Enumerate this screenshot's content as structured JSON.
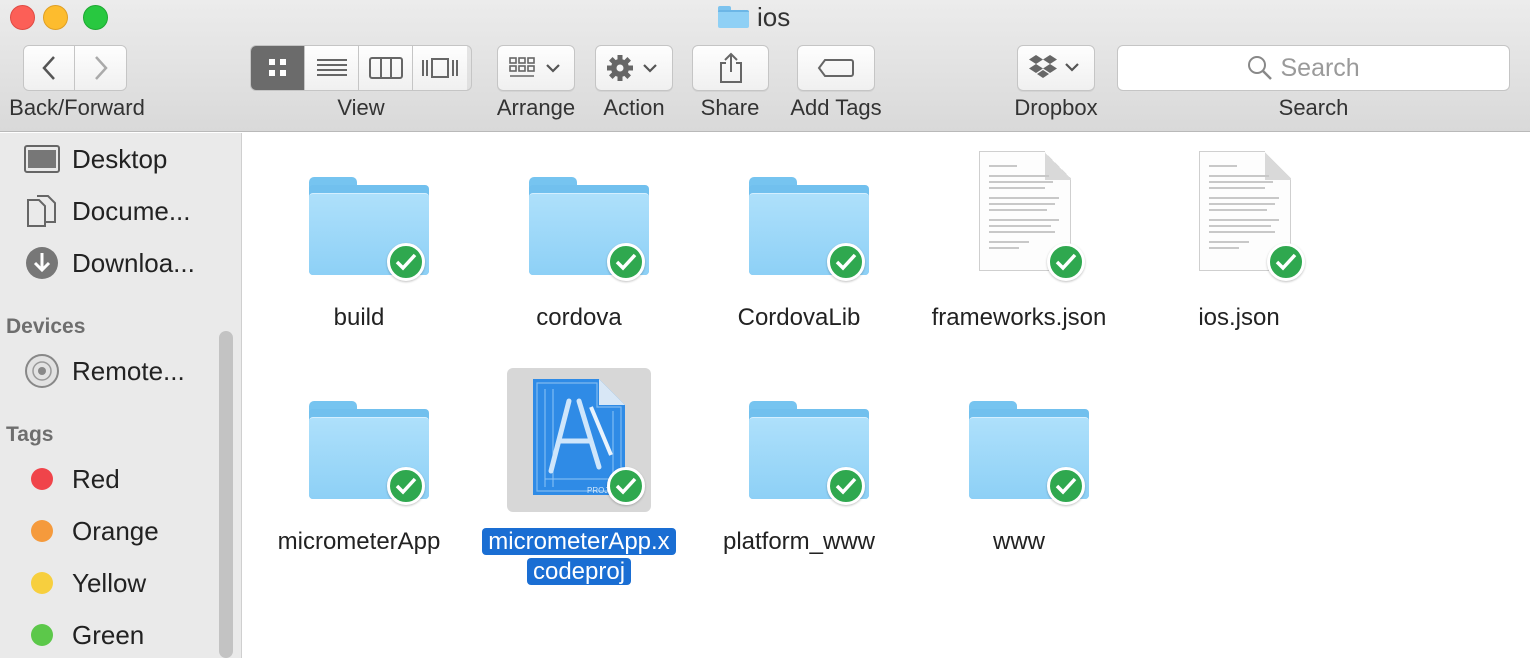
{
  "window": {
    "title": "ios",
    "title_icon": "folder-icon"
  },
  "toolbar": {
    "back_forward_label": "Back/Forward",
    "view_label": "View",
    "arrange_label": "Arrange",
    "action_label": "Action",
    "share_label": "Share",
    "add_tags_label": "Add Tags",
    "dropbox_label": "Dropbox",
    "search_label": "Search",
    "search_placeholder": "Search",
    "active_view": "icon"
  },
  "sidebar": {
    "favorites": [
      {
        "label": "Desktop",
        "icon": "desktop-icon"
      },
      {
        "label": "Docume...",
        "icon": "documents-icon"
      },
      {
        "label": "Downloa...",
        "icon": "downloads-icon"
      }
    ],
    "devices_heading": "Devices",
    "devices": [
      {
        "label": "Remote...",
        "icon": "disc-icon"
      }
    ],
    "tags_heading": "Tags",
    "tags": [
      {
        "label": "Red",
        "color": "#f0444a"
      },
      {
        "label": "Orange",
        "color": "#f59a3c"
      },
      {
        "label": "Yellow",
        "color": "#f7cf3e"
      },
      {
        "label": "Green",
        "color": "#5cc84a"
      }
    ]
  },
  "files": [
    {
      "name": "build",
      "kind": "folder",
      "synced": true
    },
    {
      "name": "cordova",
      "kind": "folder",
      "synced": true
    },
    {
      "name": "CordovaLib",
      "kind": "folder",
      "synced": true
    },
    {
      "name": "frameworks.json",
      "kind": "document",
      "synced": true
    },
    {
      "name": "ios.json",
      "kind": "document",
      "synced": true
    },
    {
      "name": "micrometerApp",
      "kind": "folder",
      "synced": true
    },
    {
      "name": "micrometerApp.xcodeproj",
      "name_line1": "micrometerApp.x",
      "name_line2": "codeproj",
      "kind": "xcodeproj",
      "synced": true,
      "selected": true
    },
    {
      "name": "platform_www",
      "kind": "folder",
      "synced": true
    },
    {
      "name": "www",
      "kind": "folder",
      "synced": true
    }
  ],
  "colors": {
    "selection": "#1a6ed3",
    "folder": "#8dd0f6",
    "sync_badge": "#2fa84f"
  }
}
